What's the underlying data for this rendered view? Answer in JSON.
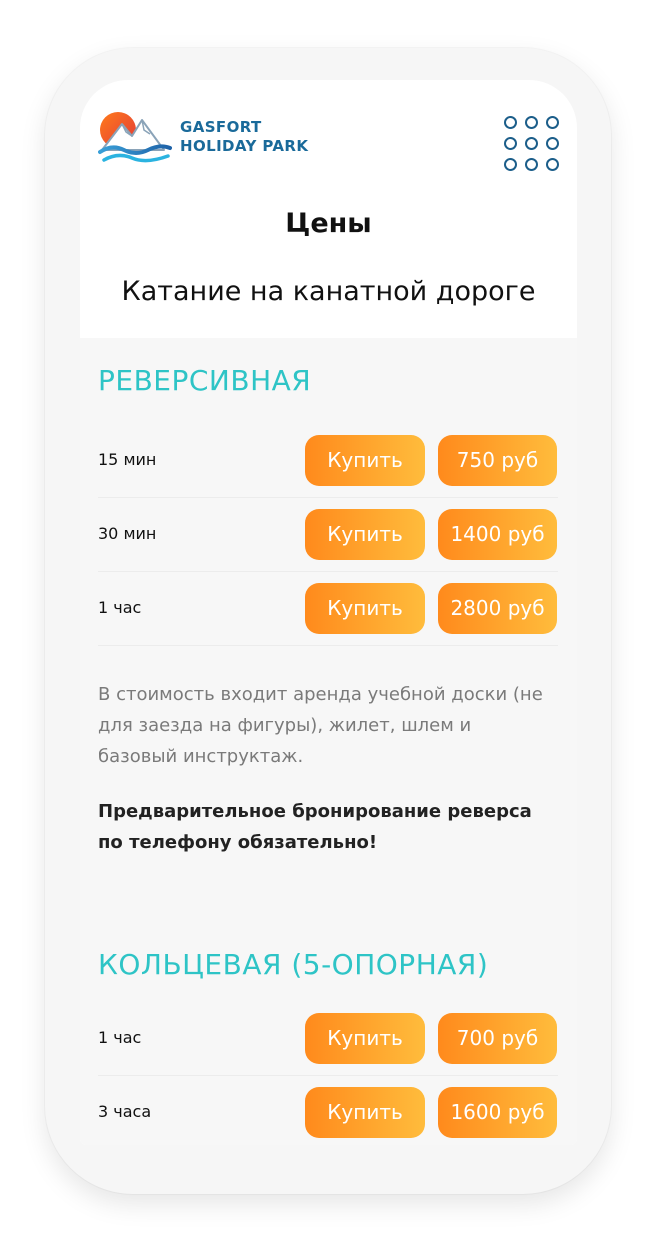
{
  "brand": {
    "line1": "GASFORT",
    "line2": "HOLIDAY PARK"
  },
  "page": {
    "title": "Цены",
    "subtitle": "Катание на канатной дороге"
  },
  "sections": [
    {
      "title": "РЕВЕРСИВНАЯ",
      "rows": [
        {
          "duration": "15 мин",
          "buy": "Купить",
          "price": "750 руб"
        },
        {
          "duration": "30 мин",
          "buy": "Купить",
          "price": "1400 руб"
        },
        {
          "duration": "1 час",
          "buy": "Купить",
          "price": "2800 руб"
        }
      ],
      "note": "В стоимость входит аренда учебной доски (не для заезда на фигуры), жилет, шлем и базовый инструктаж.",
      "warning": "Предварительное бронирование реверса по телефону обязательно!"
    },
    {
      "title": "КОЛЬЦЕВАЯ (5-ОПОРНАЯ)",
      "rows": [
        {
          "duration": "1 час",
          "buy": "Купить",
          "price": "700 руб"
        },
        {
          "duration": "3 часа",
          "buy": "Купить",
          "price": "1600 руб"
        }
      ]
    }
  ],
  "colors": {
    "accent": "#2ec4c6",
    "button_start": "#ff8a1c",
    "button_end": "#ffbc3c",
    "brand_blue": "#1a6a9a"
  },
  "icons": {
    "logo": "mountain-sun-wave-logo",
    "menu": "dots-grid-icon"
  }
}
